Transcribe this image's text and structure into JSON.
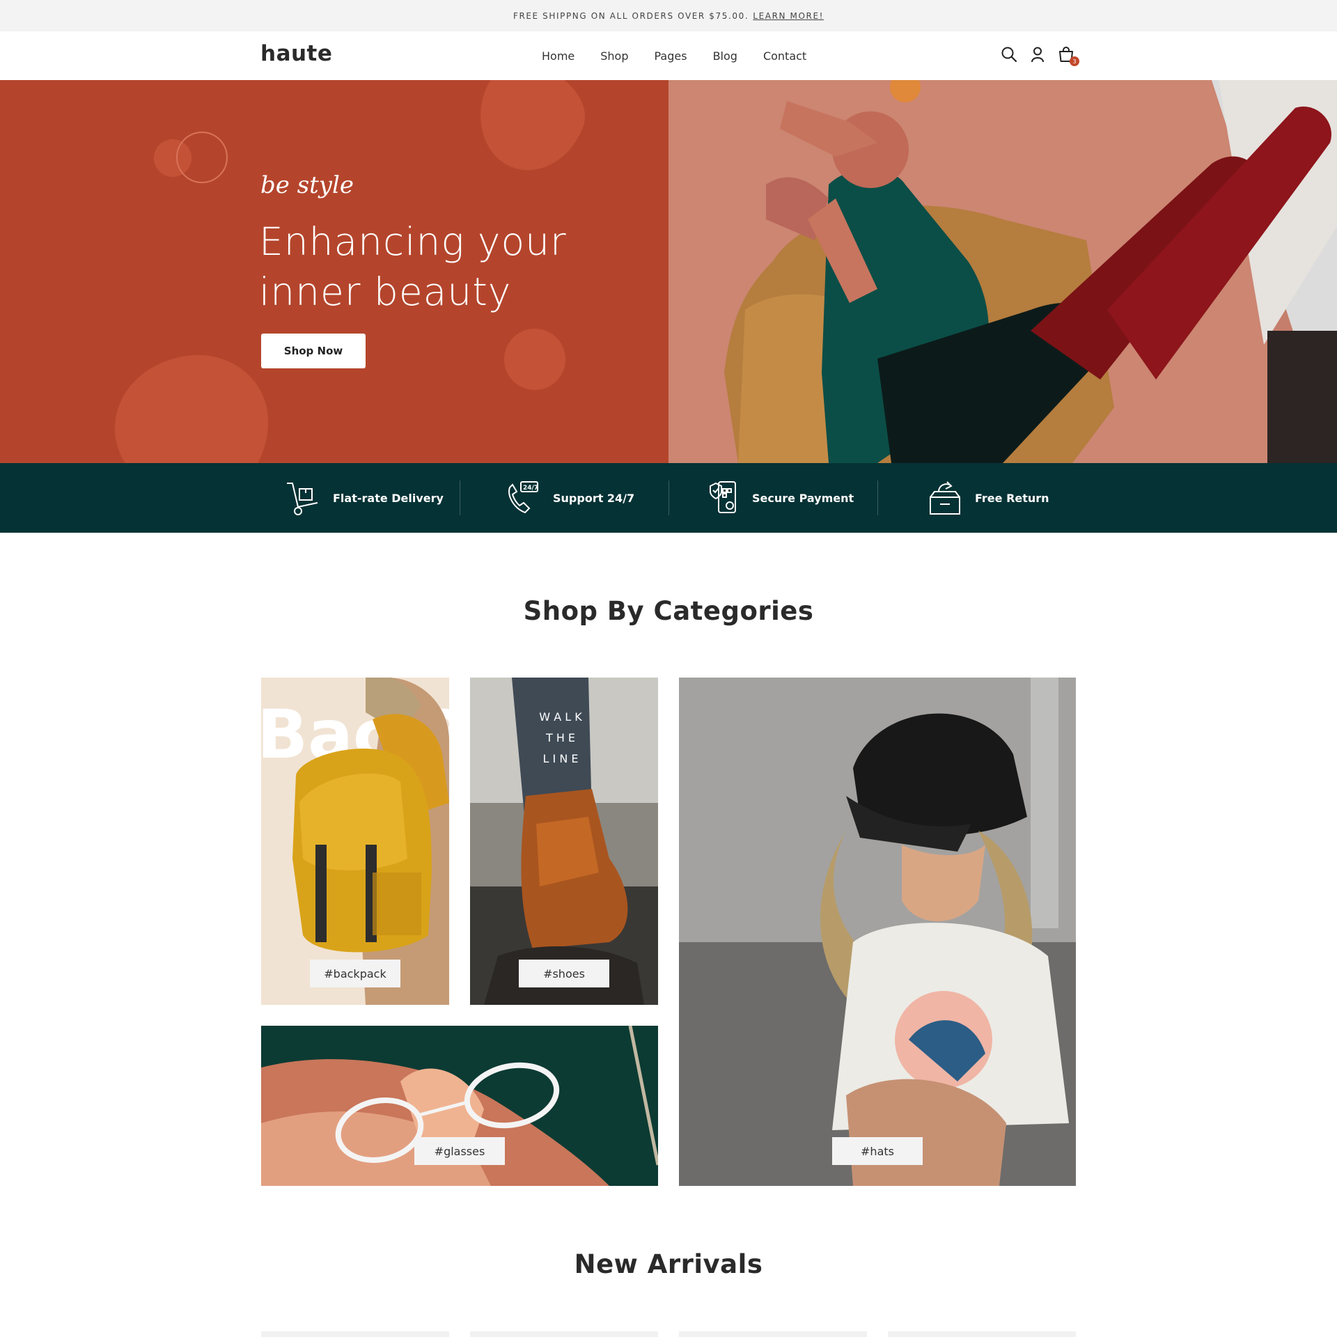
{
  "announcement": {
    "text": "FREE SHIPPNG ON ALL ORDERS OVER $75.00.",
    "link": "LEARN MORE!"
  },
  "header": {
    "logo": "haute",
    "nav": [
      "Home",
      "Shop",
      "Pages",
      "Blog",
      "Contact"
    ],
    "icons": [
      "search-icon",
      "user-icon",
      "cart-icon"
    ],
    "cart_count": "3"
  },
  "hero": {
    "script": "be style",
    "title_line1": "Enhancing your",
    "title_line2": "inner beauty",
    "button": "Shop Now",
    "bg_color": "#b4452c"
  },
  "features": [
    {
      "label": "Flat-rate Delivery",
      "icon": "hand-truck-icon"
    },
    {
      "label": "Support 24/7",
      "icon": "phone-24-7-icon",
      "icon_text": "24/7"
    },
    {
      "label": "Secure Payment",
      "icon": "secure-phone-icon"
    },
    {
      "label": "Free Return",
      "icon": "return-box-icon"
    }
  ],
  "features_bg": "#053235",
  "categories": {
    "title": "Shop By Categories",
    "tags": [
      "#backpack",
      "#shoes",
      "#glasses",
      "#hats"
    ],
    "backpack_overlay": "Bac P",
    "shoes_overlay": [
      "W A L K",
      "T H E",
      "L I N E"
    ]
  },
  "new_arrivals": {
    "title": "New Arrivals"
  },
  "accent": "#c2482a"
}
